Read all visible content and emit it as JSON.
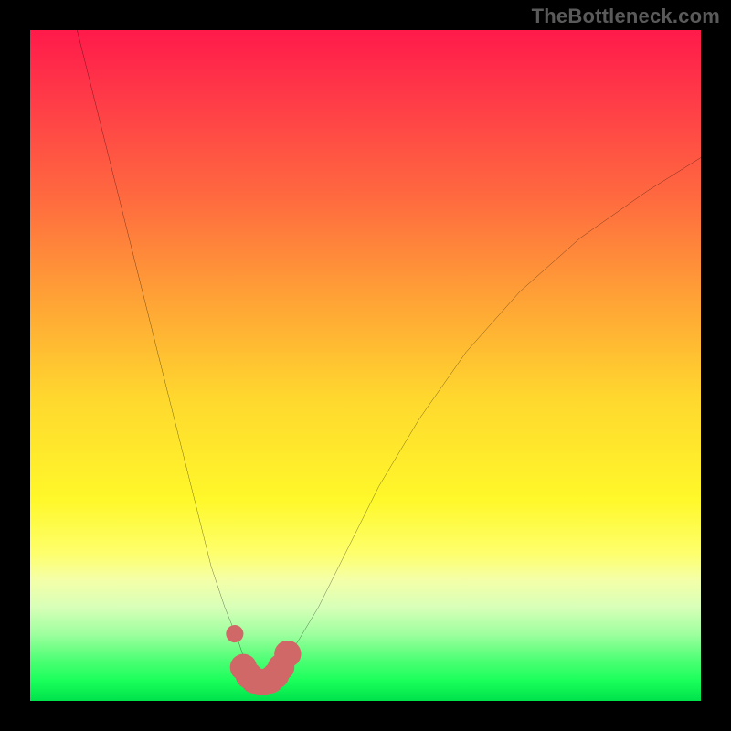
{
  "watermark": "TheBottleneck.com",
  "chart_data": {
    "type": "line",
    "title": "",
    "xlabel": "",
    "ylabel": "",
    "xlim": [
      0,
      100
    ],
    "ylim": [
      0,
      100
    ],
    "series": [
      {
        "name": "bottleneck-curve",
        "x": [
          7,
          10,
          13,
          16,
          19,
          22,
          25,
          27,
          29,
          31,
          32,
          33,
          34,
          35,
          36,
          37,
          38,
          40,
          43,
          47,
          52,
          58,
          65,
          73,
          82,
          92,
          100
        ],
        "y": [
          100,
          88,
          76,
          64,
          52,
          40,
          28,
          20,
          14,
          9,
          6,
          4,
          3,
          3,
          3,
          4,
          6,
          9,
          14,
          22,
          32,
          42,
          52,
          61,
          69,
          76,
          81
        ]
      }
    ],
    "markers": [
      {
        "name": "marker-left",
        "x": 30.5,
        "y": 10,
        "r": 1.3,
        "color": "#d06868"
      },
      {
        "name": "marker-bottom-blob",
        "type": "blob",
        "color": "#d06868",
        "points_x": [
          31.8,
          32.6,
          33.4,
          34.2,
          35.0,
          35.8,
          36.6,
          37.4,
          38.4
        ],
        "points_y": [
          5.0,
          3.8,
          3.1,
          2.8,
          2.8,
          3.1,
          3.8,
          5.0,
          7.0
        ],
        "r": 2.0
      }
    ],
    "gradient_stops": [
      {
        "pos": 0,
        "color": "#ff1a4a"
      },
      {
        "pos": 25,
        "color": "#ff6a3f"
      },
      {
        "pos": 55,
        "color": "#ffd82e"
      },
      {
        "pos": 78,
        "color": "#feff6c"
      },
      {
        "pos": 90,
        "color": "#9fff9f"
      },
      {
        "pos": 100,
        "color": "#00e24b"
      }
    ]
  }
}
